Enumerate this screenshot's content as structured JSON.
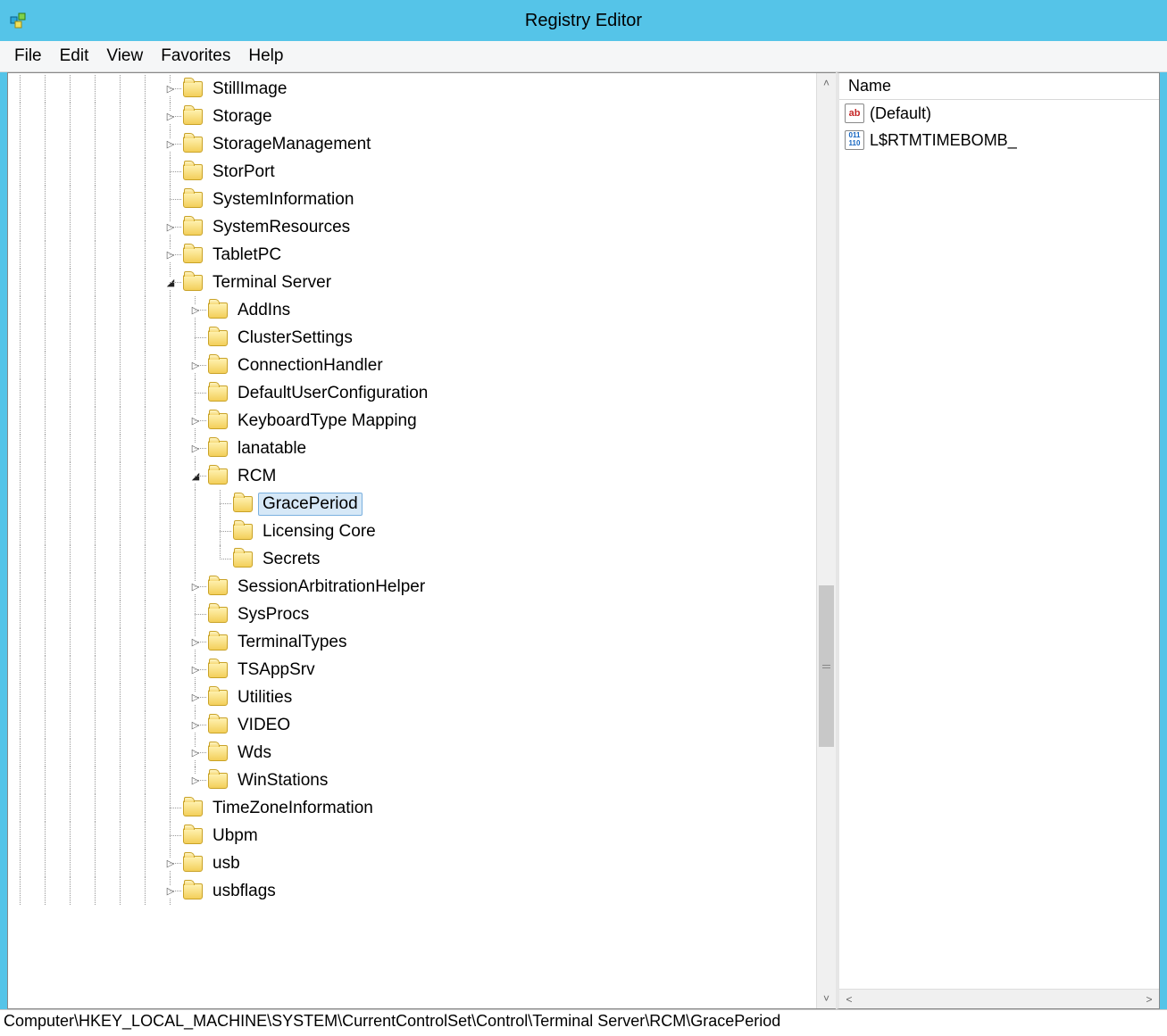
{
  "window": {
    "title": "Registry Editor"
  },
  "menu": {
    "items": [
      "File",
      "Edit",
      "View",
      "Favorites",
      "Help"
    ]
  },
  "tree": [
    {
      "label": "StillImage",
      "indent": [
        "v",
        "v",
        "v",
        "v",
        "v",
        "v",
        "tee"
      ],
      "expander": "closed"
    },
    {
      "label": "Storage",
      "indent": [
        "v",
        "v",
        "v",
        "v",
        "v",
        "v",
        "tee"
      ],
      "expander": "closed"
    },
    {
      "label": "StorageManagement",
      "indent": [
        "v",
        "v",
        "v",
        "v",
        "v",
        "v",
        "tee"
      ],
      "expander": "closed"
    },
    {
      "label": "StorPort",
      "indent": [
        "v",
        "v",
        "v",
        "v",
        "v",
        "v",
        "tee"
      ],
      "expander": ""
    },
    {
      "label": "SystemInformation",
      "indent": [
        "v",
        "v",
        "v",
        "v",
        "v",
        "v",
        "tee"
      ],
      "expander": ""
    },
    {
      "label": "SystemResources",
      "indent": [
        "v",
        "v",
        "v",
        "v",
        "v",
        "v",
        "tee"
      ],
      "expander": "closed"
    },
    {
      "label": "TabletPC",
      "indent": [
        "v",
        "v",
        "v",
        "v",
        "v",
        "v",
        "tee"
      ],
      "expander": "closed"
    },
    {
      "label": "Terminal Server",
      "indent": [
        "v",
        "v",
        "v",
        "v",
        "v",
        "v",
        "tee"
      ],
      "expander": "open"
    },
    {
      "label": "AddIns",
      "indent": [
        "v",
        "v",
        "v",
        "v",
        "v",
        "v",
        "v",
        "tee"
      ],
      "expander": "closed"
    },
    {
      "label": "ClusterSettings",
      "indent": [
        "v",
        "v",
        "v",
        "v",
        "v",
        "v",
        "v",
        "tee"
      ],
      "expander": ""
    },
    {
      "label": "ConnectionHandler",
      "indent": [
        "v",
        "v",
        "v",
        "v",
        "v",
        "v",
        "v",
        "tee"
      ],
      "expander": "closed"
    },
    {
      "label": "DefaultUserConfiguration",
      "indent": [
        "v",
        "v",
        "v",
        "v",
        "v",
        "v",
        "v",
        "tee"
      ],
      "expander": ""
    },
    {
      "label": "KeyboardType Mapping",
      "indent": [
        "v",
        "v",
        "v",
        "v",
        "v",
        "v",
        "v",
        "tee"
      ],
      "expander": "closed"
    },
    {
      "label": "lanatable",
      "indent": [
        "v",
        "v",
        "v",
        "v",
        "v",
        "v",
        "v",
        "tee"
      ],
      "expander": "closed"
    },
    {
      "label": "RCM",
      "indent": [
        "v",
        "v",
        "v",
        "v",
        "v",
        "v",
        "v",
        "tee"
      ],
      "expander": "open"
    },
    {
      "label": "GracePeriod",
      "indent": [
        "v",
        "v",
        "v",
        "v",
        "v",
        "v",
        "v",
        "v",
        "tee"
      ],
      "expander": "",
      "selected": true
    },
    {
      "label": "Licensing Core",
      "indent": [
        "v",
        "v",
        "v",
        "v",
        "v",
        "v",
        "v",
        "v",
        "tee"
      ],
      "expander": ""
    },
    {
      "label": "Secrets",
      "indent": [
        "v",
        "v",
        "v",
        "v",
        "v",
        "v",
        "v",
        "v",
        "ell"
      ],
      "expander": ""
    },
    {
      "label": "SessionArbitrationHelper",
      "indent": [
        "v",
        "v",
        "v",
        "v",
        "v",
        "v",
        "v",
        "tee"
      ],
      "expander": "closed"
    },
    {
      "label": "SysProcs",
      "indent": [
        "v",
        "v",
        "v",
        "v",
        "v",
        "v",
        "v",
        "tee"
      ],
      "expander": ""
    },
    {
      "label": "TerminalTypes",
      "indent": [
        "v",
        "v",
        "v",
        "v",
        "v",
        "v",
        "v",
        "tee"
      ],
      "expander": "closed"
    },
    {
      "label": "TSAppSrv",
      "indent": [
        "v",
        "v",
        "v",
        "v",
        "v",
        "v",
        "v",
        "tee"
      ],
      "expander": "closed"
    },
    {
      "label": "Utilities",
      "indent": [
        "v",
        "v",
        "v",
        "v",
        "v",
        "v",
        "v",
        "tee"
      ],
      "expander": "closed"
    },
    {
      "label": "VIDEO",
      "indent": [
        "v",
        "v",
        "v",
        "v",
        "v",
        "v",
        "v",
        "tee"
      ],
      "expander": "closed"
    },
    {
      "label": "Wds",
      "indent": [
        "v",
        "v",
        "v",
        "v",
        "v",
        "v",
        "v",
        "tee"
      ],
      "expander": "closed"
    },
    {
      "label": "WinStations",
      "indent": [
        "v",
        "v",
        "v",
        "v",
        "v",
        "v",
        "v",
        "ell"
      ],
      "expander": "closed"
    },
    {
      "label": "TimeZoneInformation",
      "indent": [
        "v",
        "v",
        "v",
        "v",
        "v",
        "v",
        "tee"
      ],
      "expander": ""
    },
    {
      "label": "Ubpm",
      "indent": [
        "v",
        "v",
        "v",
        "v",
        "v",
        "v",
        "tee"
      ],
      "expander": ""
    },
    {
      "label": "usb",
      "indent": [
        "v",
        "v",
        "v",
        "v",
        "v",
        "v",
        "tee"
      ],
      "expander": "closed"
    },
    {
      "label": "usbflags",
      "indent": [
        "v",
        "v",
        "v",
        "v",
        "v",
        "v",
        "tee"
      ],
      "expander": "closed"
    }
  ],
  "values": {
    "header": "Name",
    "rows": [
      {
        "icon": "str",
        "glyph": "ab",
        "name": "(Default)"
      },
      {
        "icon": "bin",
        "glyph": "011\n110",
        "name": "L$RTMTIMEBOMB_"
      }
    ]
  },
  "status": "Computer\\HKEY_LOCAL_MACHINE\\SYSTEM\\CurrentControlSet\\Control\\Terminal Server\\RCM\\GracePeriod"
}
